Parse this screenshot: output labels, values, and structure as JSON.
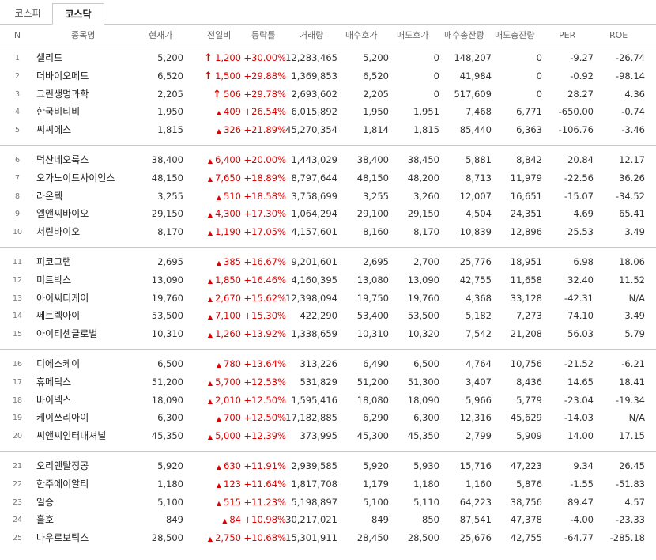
{
  "tabs": [
    "코스피",
    "코스닥"
  ],
  "active_tab": "코스닥",
  "columns": [
    "N",
    "종목명",
    "현재가",
    "전일비",
    "등락률",
    "거래량",
    "매수호가",
    "매도호가",
    "매수총잔량",
    "매도총잔량",
    "PER",
    "ROE"
  ],
  "colors": {
    "up": "#dd0000"
  },
  "rows": [
    {
      "n": "1",
      "name": "셀리드",
      "price": "5,200",
      "change_icon": "limit-up-arrow",
      "change": "1,200",
      "rate": "+30.00%",
      "volume": "12,283,465",
      "bid": "5,200",
      "ask": "0",
      "bid_qty": "148,207",
      "ask_qty": "0",
      "per": "-9.27",
      "roe": "-26.74"
    },
    {
      "n": "2",
      "name": "더바이오메드",
      "price": "6,520",
      "change_icon": "limit-up-arrow",
      "change": "1,500",
      "rate": "+29.88%",
      "volume": "1,369,853",
      "bid": "6,520",
      "ask": "0",
      "bid_qty": "41,984",
      "ask_qty": "0",
      "per": "-0.92",
      "roe": "-98.14"
    },
    {
      "n": "3",
      "name": "그린생명과학",
      "price": "2,205",
      "change_icon": "limit-up-arrow",
      "change": "506",
      "rate": "+29.78%",
      "volume": "2,693,602",
      "bid": "2,205",
      "ask": "0",
      "bid_qty": "517,609",
      "ask_qty": "0",
      "per": "28.27",
      "roe": "4.36"
    },
    {
      "n": "4",
      "name": "한국비티비",
      "price": "1,950",
      "change_icon": "up-triangle",
      "change": "409",
      "rate": "+26.54%",
      "volume": "6,015,892",
      "bid": "1,950",
      "ask": "1,951",
      "bid_qty": "7,468",
      "ask_qty": "6,771",
      "per": "-650.00",
      "roe": "-0.74"
    },
    {
      "n": "5",
      "name": "씨씨에스",
      "price": "1,815",
      "change_icon": "up-triangle",
      "change": "326",
      "rate": "+21.89%",
      "volume": "45,270,354",
      "bid": "1,814",
      "ask": "1,815",
      "bid_qty": "85,440",
      "ask_qty": "6,363",
      "per": "-106.76",
      "roe": "-3.46"
    },
    {
      "n": "6",
      "name": "덕산네오룩스",
      "price": "38,400",
      "change_icon": "up-triangle",
      "change": "6,400",
      "rate": "+20.00%",
      "volume": "1,443,029",
      "bid": "38,400",
      "ask": "38,450",
      "bid_qty": "5,881",
      "ask_qty": "8,842",
      "per": "20.84",
      "roe": "12.17"
    },
    {
      "n": "7",
      "name": "오가노이드사이언스",
      "price": "48,150",
      "change_icon": "up-triangle",
      "change": "7,650",
      "rate": "+18.89%",
      "volume": "8,797,644",
      "bid": "48,150",
      "ask": "48,200",
      "bid_qty": "8,713",
      "ask_qty": "11,979",
      "per": "-22.56",
      "roe": "36.26"
    },
    {
      "n": "8",
      "name": "라온텍",
      "price": "3,255",
      "change_icon": "up-triangle",
      "change": "510",
      "rate": "+18.58%",
      "volume": "3,758,699",
      "bid": "3,255",
      "ask": "3,260",
      "bid_qty": "12,007",
      "ask_qty": "16,651",
      "per": "-15.07",
      "roe": "-34.52"
    },
    {
      "n": "9",
      "name": "엘앤씨바이오",
      "price": "29,150",
      "change_icon": "up-triangle",
      "change": "4,300",
      "rate": "+17.30%",
      "volume": "1,064,294",
      "bid": "29,100",
      "ask": "29,150",
      "bid_qty": "4,504",
      "ask_qty": "24,351",
      "per": "4.69",
      "roe": "65.41"
    },
    {
      "n": "10",
      "name": "서린바이오",
      "price": "8,170",
      "change_icon": "up-triangle",
      "change": "1,190",
      "rate": "+17.05%",
      "volume": "4,157,601",
      "bid": "8,160",
      "ask": "8,170",
      "bid_qty": "10,839",
      "ask_qty": "12,896",
      "per": "25.53",
      "roe": "3.49"
    },
    {
      "n": "11",
      "name": "피코그램",
      "price": "2,695",
      "change_icon": "up-triangle",
      "change": "385",
      "rate": "+16.67%",
      "volume": "9,201,601",
      "bid": "2,695",
      "ask": "2,700",
      "bid_qty": "25,776",
      "ask_qty": "18,951",
      "per": "6.98",
      "roe": "18.06"
    },
    {
      "n": "12",
      "name": "미트박스",
      "price": "13,090",
      "change_icon": "up-triangle",
      "change": "1,850",
      "rate": "+16.46%",
      "volume": "4,160,395",
      "bid": "13,080",
      "ask": "13,090",
      "bid_qty": "42,755",
      "ask_qty": "11,658",
      "per": "32.40",
      "roe": "11.52"
    },
    {
      "n": "13",
      "name": "아이씨티케이",
      "price": "19,760",
      "change_icon": "up-triangle",
      "change": "2,670",
      "rate": "+15.62%",
      "volume": "12,398,094",
      "bid": "19,750",
      "ask": "19,760",
      "bid_qty": "4,368",
      "ask_qty": "33,128",
      "per": "-42.31",
      "roe": "N/A"
    },
    {
      "n": "14",
      "name": "쎄트렉아이",
      "price": "53,500",
      "change_icon": "up-triangle",
      "change": "7,100",
      "rate": "+15.30%",
      "volume": "422,290",
      "bid": "53,400",
      "ask": "53,500",
      "bid_qty": "5,182",
      "ask_qty": "7,273",
      "per": "74.10",
      "roe": "3.49"
    },
    {
      "n": "15",
      "name": "아이티센글로벌",
      "price": "10,310",
      "change_icon": "up-triangle",
      "change": "1,260",
      "rate": "+13.92%",
      "volume": "1,338,659",
      "bid": "10,310",
      "ask": "10,320",
      "bid_qty": "7,542",
      "ask_qty": "21,208",
      "per": "56.03",
      "roe": "5.79"
    },
    {
      "n": "16",
      "name": "디에스케이",
      "price": "6,500",
      "change_icon": "up-triangle",
      "change": "780",
      "rate": "+13.64%",
      "volume": "313,226",
      "bid": "6,490",
      "ask": "6,500",
      "bid_qty": "4,764",
      "ask_qty": "10,756",
      "per": "-21.52",
      "roe": "-6.21"
    },
    {
      "n": "17",
      "name": "휴메딕스",
      "price": "51,200",
      "change_icon": "up-triangle",
      "change": "5,700",
      "rate": "+12.53%",
      "volume": "531,829",
      "bid": "51,200",
      "ask": "51,300",
      "bid_qty": "3,407",
      "ask_qty": "8,436",
      "per": "14.65",
      "roe": "18.41"
    },
    {
      "n": "18",
      "name": "바이넥스",
      "price": "18,090",
      "change_icon": "up-triangle",
      "change": "2,010",
      "rate": "+12.50%",
      "volume": "1,595,416",
      "bid": "18,080",
      "ask": "18,090",
      "bid_qty": "5,966",
      "ask_qty": "5,779",
      "per": "-23.04",
      "roe": "-19.34"
    },
    {
      "n": "19",
      "name": "케이쓰리아이",
      "price": "6,300",
      "change_icon": "up-triangle",
      "change": "700",
      "rate": "+12.50%",
      "volume": "17,182,885",
      "bid": "6,290",
      "ask": "6,300",
      "bid_qty": "12,316",
      "ask_qty": "45,629",
      "per": "-14.03",
      "roe": "N/A"
    },
    {
      "n": "20",
      "name": "씨앤씨인터내셔널",
      "price": "45,350",
      "change_icon": "up-triangle",
      "change": "5,000",
      "rate": "+12.39%",
      "volume": "373,995",
      "bid": "45,300",
      "ask": "45,350",
      "bid_qty": "2,799",
      "ask_qty": "5,909",
      "per": "14.00",
      "roe": "17.15"
    },
    {
      "n": "21",
      "name": "오리엔탈정공",
      "price": "5,920",
      "change_icon": "up-triangle",
      "change": "630",
      "rate": "+11.91%",
      "volume": "2,939,585",
      "bid": "5,920",
      "ask": "5,930",
      "bid_qty": "15,716",
      "ask_qty": "47,223",
      "per": "9.34",
      "roe": "26.45"
    },
    {
      "n": "22",
      "name": "한주에이알티",
      "price": "1,180",
      "change_icon": "up-triangle",
      "change": "123",
      "rate": "+11.64%",
      "volume": "1,817,708",
      "bid": "1,179",
      "ask": "1,180",
      "bid_qty": "1,160",
      "ask_qty": "5,876",
      "per": "-1.55",
      "roe": "-51.83"
    },
    {
      "n": "23",
      "name": "일승",
      "price": "5,100",
      "change_icon": "up-triangle",
      "change": "515",
      "rate": "+11.23%",
      "volume": "5,198,897",
      "bid": "5,100",
      "ask": "5,110",
      "bid_qty": "64,223",
      "ask_qty": "38,756",
      "per": "89.47",
      "roe": "4.57"
    },
    {
      "n": "24",
      "name": "휼호",
      "price": "849",
      "change_icon": "up-triangle",
      "change": "84",
      "rate": "+10.98%",
      "volume": "30,217,021",
      "bid": "849",
      "ask": "850",
      "bid_qty": "87,541",
      "ask_qty": "47,378",
      "per": "-4.00",
      "roe": "-23.33"
    },
    {
      "n": "25",
      "name": "나우로보틱스",
      "price": "28,500",
      "change_icon": "up-triangle",
      "change": "2,750",
      "rate": "+10.68%",
      "volume": "15,301,911",
      "bid": "28,450",
      "ask": "28,500",
      "bid_qty": "25,676",
      "ask_qty": "42,755",
      "per": "-64.77",
      "roe": "-285.18"
    }
  ]
}
